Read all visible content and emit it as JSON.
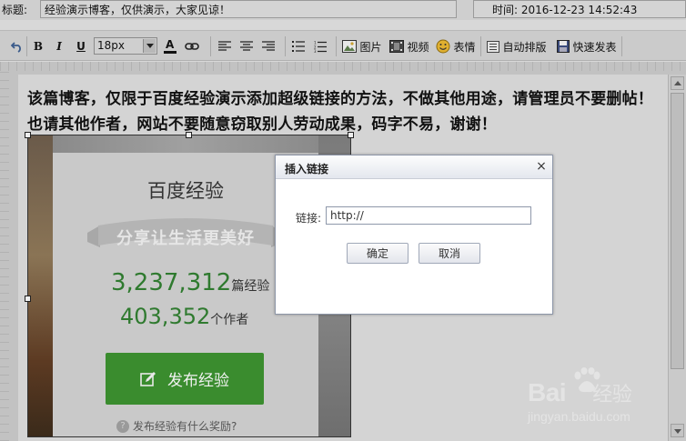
{
  "header": {
    "title_label": "标题:",
    "title_value": "经验演示博客，仅供演示，大家见谅！",
    "time_label": "时间:",
    "time_value": "2016-12-23 14:52:43"
  },
  "toolbar": {
    "font_size": "18px",
    "items": [
      {
        "name": "image",
        "label": "图片",
        "icon": "image-icon"
      },
      {
        "name": "video",
        "label": "视频",
        "icon": "video-icon"
      },
      {
        "name": "emoji",
        "label": "表情",
        "icon": "smiley-icon"
      },
      {
        "name": "autoformat",
        "label": "自动排版",
        "icon": "autoformat-icon"
      },
      {
        "name": "quickpost",
        "label": "快速发表",
        "icon": "save-icon"
      }
    ]
  },
  "editor": {
    "post_text": "该篇博客，仅限于百度经验演示添加超级链接的方法，不做其他用途，请管理员不要删帖！也请其他作者，网站不要随意窃取别人劳动成果，码字不易，谢谢！"
  },
  "embedded_image": {
    "title": "百度经验",
    "slogan": "分享让生活更美好",
    "stat1_value": "3,237,312",
    "stat1_unit": "篇经验",
    "stat2_value": "403,352",
    "stat2_unit": "个作者",
    "publish_label": "发布经验",
    "reward_text": "发布经验有什么奖励?",
    "accent_color": "#3a8c2e"
  },
  "dialog": {
    "title": "插入链接",
    "close": "×",
    "link_label": "链接:",
    "link_value": "http://",
    "confirm_label": "确定",
    "cancel_label": "取消"
  },
  "watermark": {
    "brand": "Bai",
    "brand_suffix": "经验",
    "url": "jingyan.baidu.com"
  }
}
